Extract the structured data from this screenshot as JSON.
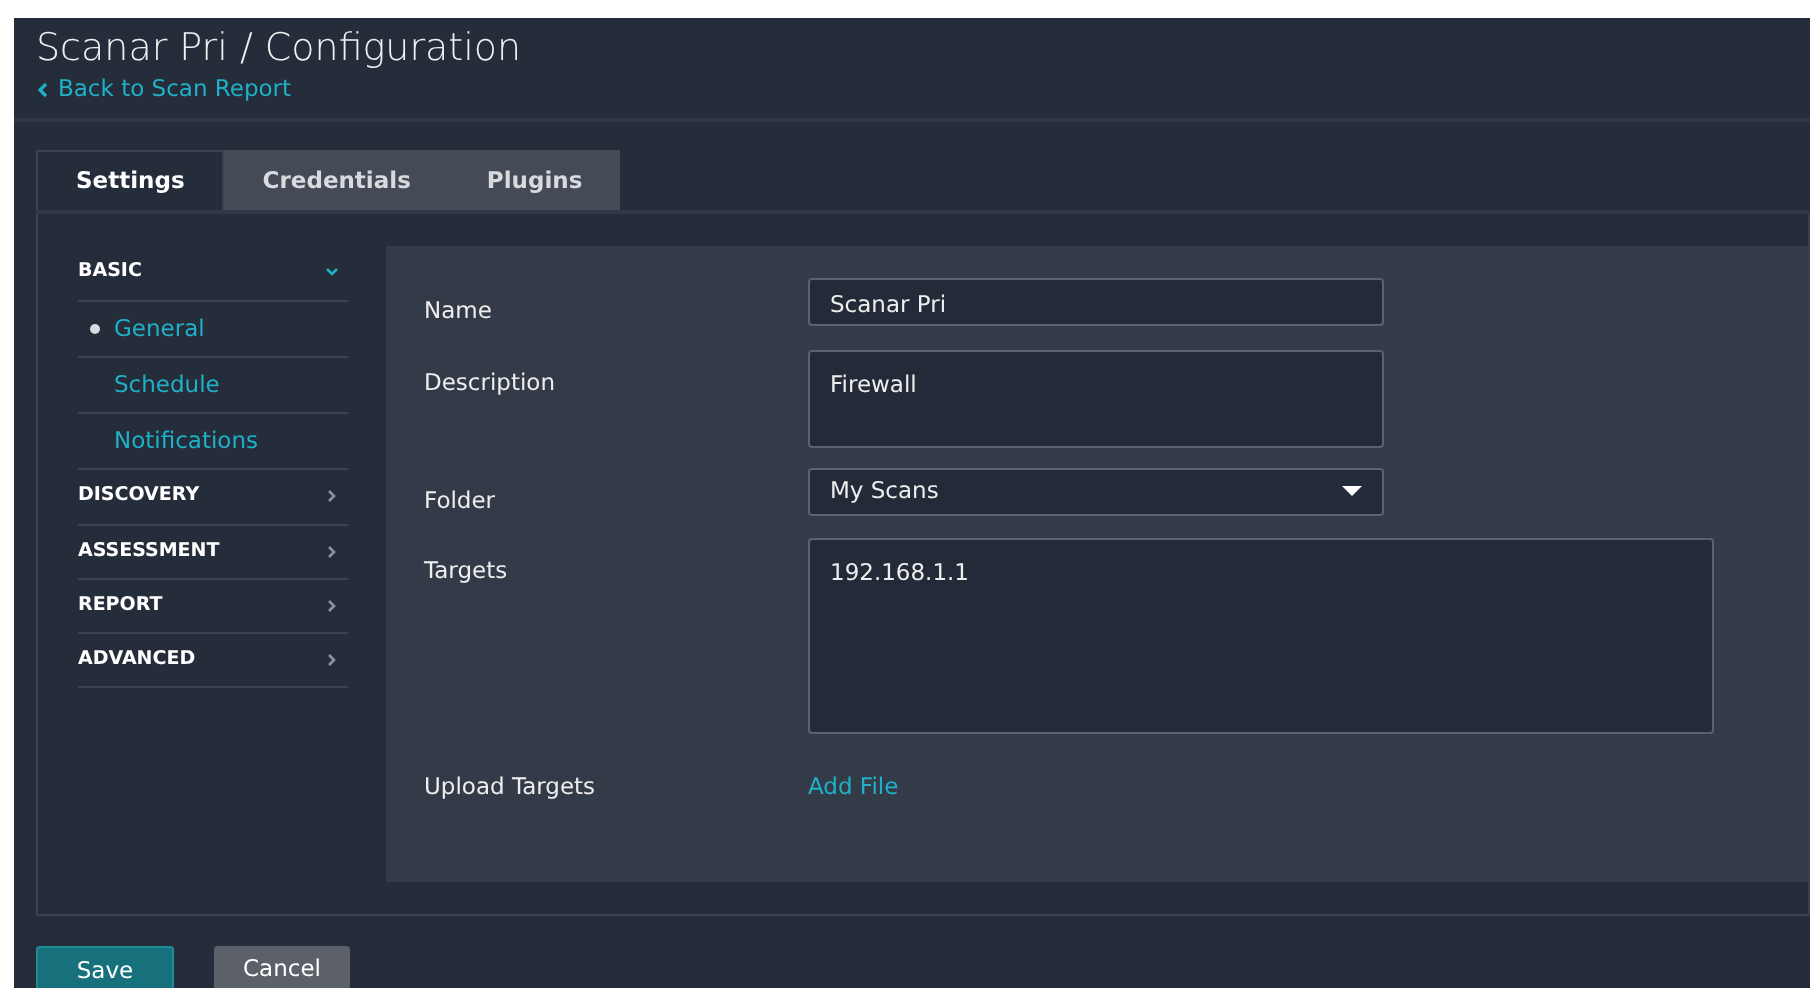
{
  "page": {
    "title": "Scanar Pri / Configuration",
    "back_link": "Back to Scan Report"
  },
  "tabs": [
    {
      "label": "Settings",
      "selected": true
    },
    {
      "label": "Credentials",
      "selected": false
    },
    {
      "label": "Plugins",
      "selected": false
    }
  ],
  "sidebar": {
    "sections": [
      {
        "label": "BASIC",
        "expanded": true,
        "items": [
          {
            "label": "General",
            "selected": true
          },
          {
            "label": "Schedule",
            "selected": false
          },
          {
            "label": "Notifications",
            "selected": false
          }
        ]
      },
      {
        "label": "DISCOVERY",
        "expanded": false
      },
      {
        "label": "ASSESSMENT",
        "expanded": false
      },
      {
        "label": "REPORT",
        "expanded": false
      },
      {
        "label": "ADVANCED",
        "expanded": false
      }
    ]
  },
  "form": {
    "fields": [
      {
        "kind": "text",
        "label": "Name",
        "value": "Scanar Pri"
      },
      {
        "kind": "textarea",
        "label": "Description",
        "value": "Firewall"
      },
      {
        "kind": "select",
        "label": "Folder",
        "value": "My Scans"
      },
      {
        "kind": "bigtextarea",
        "label": "Targets",
        "value": "192.168.1.1"
      },
      {
        "kind": "link",
        "label": "Upload Targets",
        "value": "Add File"
      }
    ]
  },
  "buttons": [
    {
      "kind": "primary",
      "label": "Save"
    },
    {
      "kind": "secondary",
      "label": "Cancel"
    }
  ]
}
